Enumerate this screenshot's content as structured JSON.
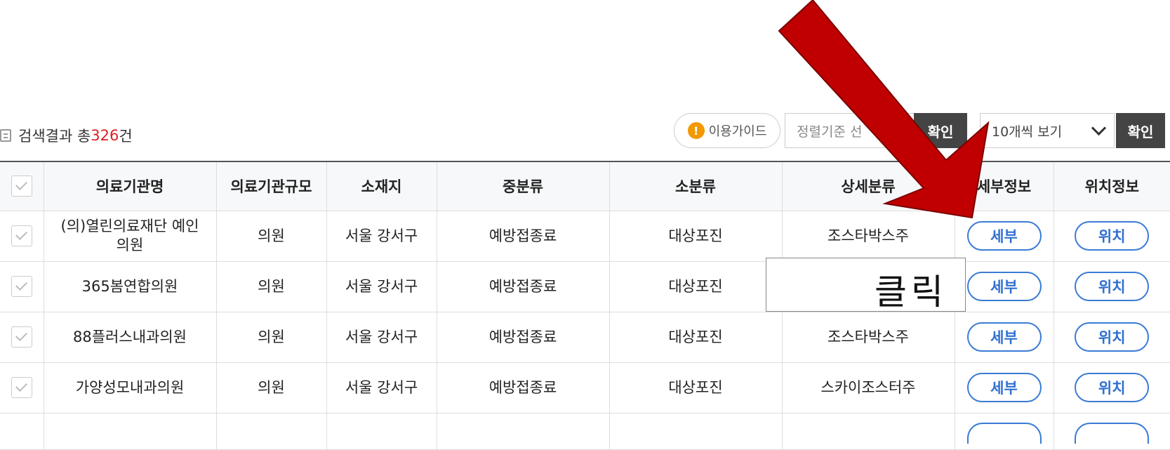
{
  "results": {
    "prefix": "검색결과 총",
    "count": "326",
    "suffix": "건"
  },
  "toolbar": {
    "guide_label": "이용가이드",
    "sort_placeholder": "정렬기준 선",
    "sort_confirm_label": "확인",
    "per_page_value": "10개씩 보기",
    "confirm_label": "확인"
  },
  "table": {
    "headers": [
      "의료기관명",
      "의료기관규모",
      "소재지",
      "중분류",
      "소분류",
      "상세분류",
      "세부정보",
      "위치정보"
    ],
    "rows": [
      {
        "name": "(의)열린의료재단 예인의원",
        "size": "의원",
        "location": "서울 강서구",
        "mid": "예방접종료",
        "small": "대상포진",
        "detail": "조스타박스주",
        "detail_btn": "세부",
        "loc_btn": "위치"
      },
      {
        "name": "365봄연합의원",
        "size": "의원",
        "location": "서울 강서구",
        "mid": "예방접종료",
        "small": "대상포진",
        "detail": "",
        "detail_btn": "세부",
        "loc_btn": "위치"
      },
      {
        "name": "88플러스내과의원",
        "size": "의원",
        "location": "서울 강서구",
        "mid": "예방접종료",
        "small": "대상포진",
        "detail": "조스타박스주",
        "detail_btn": "세부",
        "loc_btn": "위치"
      },
      {
        "name": "가양성모내과의원",
        "size": "의원",
        "location": "서울 강서구",
        "mid": "예방접종료",
        "small": "대상포진",
        "detail": "스카이조스터주",
        "detail_btn": "세부",
        "loc_btn": "위치"
      }
    ]
  },
  "annotation": {
    "text": "클릭",
    "arrow_color": "#c00000"
  }
}
